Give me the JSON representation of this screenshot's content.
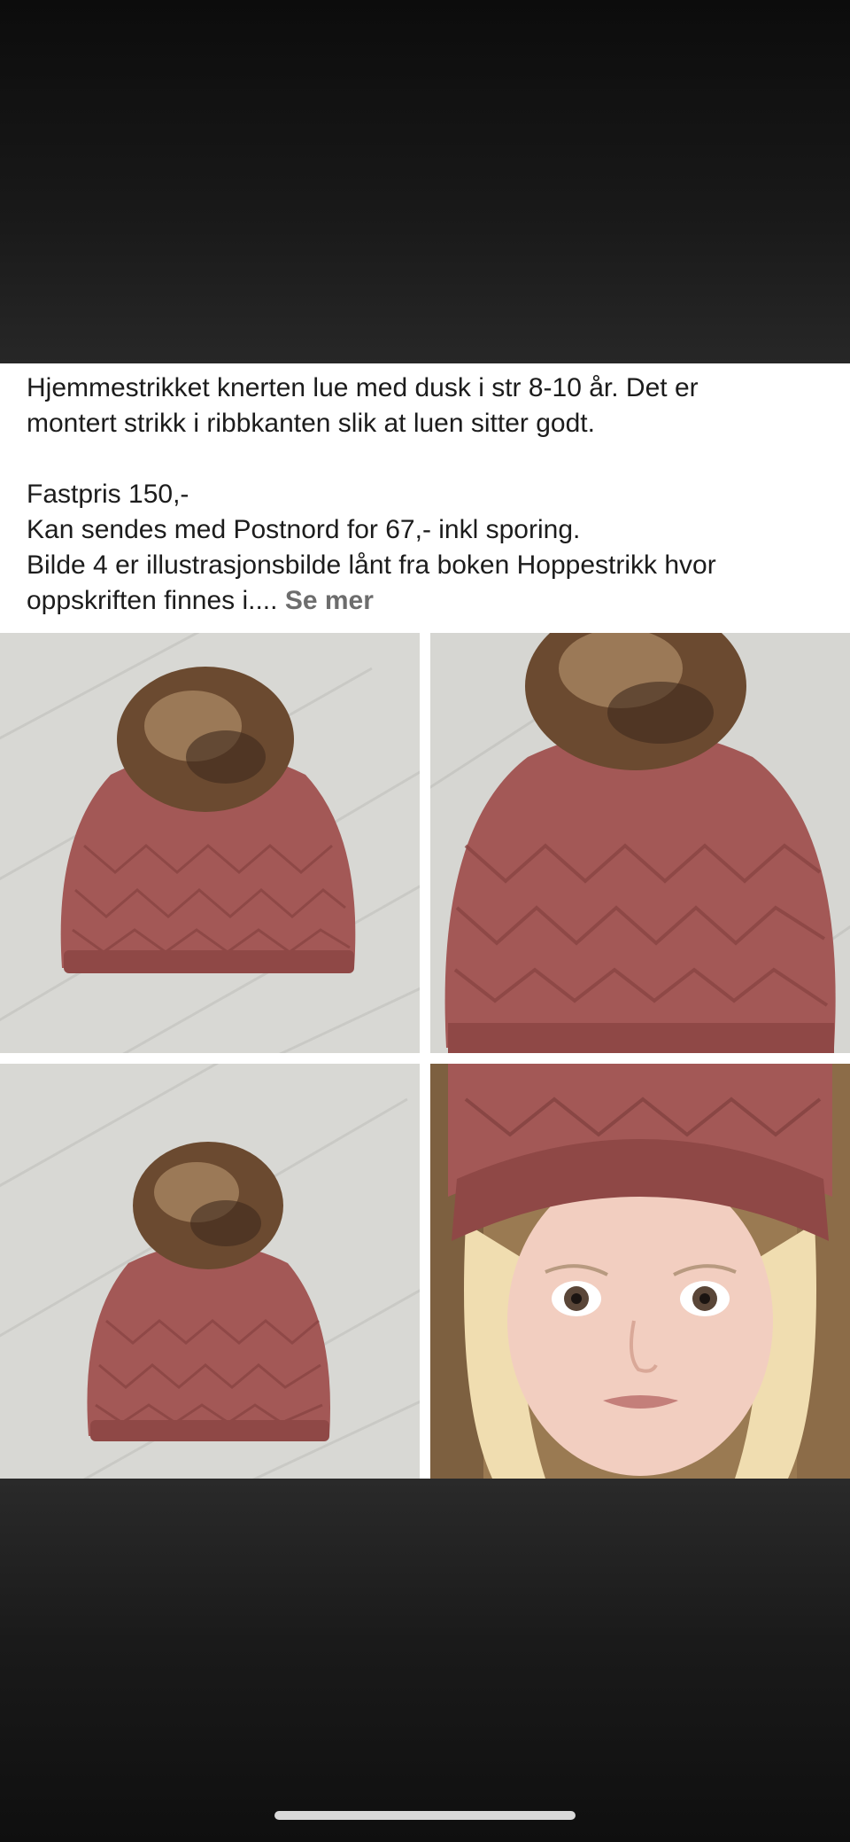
{
  "post": {
    "line1": "Hjemmestrikket knerten lue med dusk i str 8-10 år. Det er",
    "line2": "montert strikk i ribbkanten slik at luen sitter godt.",
    "line3": "Fastpris 150,-",
    "line4": "Kan sendes med Postnord for 67,- inkl sporing.",
    "line5": "Bilde 4 er illustrasjonsbilde lånt fra boken Hoppestrikk hvor",
    "line6": "oppskriften finnes i.... ",
    "see_more": "Se mer"
  },
  "photos": [
    {
      "subject": "knitted-hat-pompom-flatlay"
    },
    {
      "subject": "knitted-hat-pompom-closeup"
    },
    {
      "subject": "knitted-hat-pompom-flatlay-small"
    },
    {
      "subject": "child-wearing-knitted-hat"
    }
  ],
  "colors": {
    "yarn": "#a35856",
    "pompom": "#6b4a30",
    "floor": "#d6d6d2",
    "background": "#111111"
  }
}
